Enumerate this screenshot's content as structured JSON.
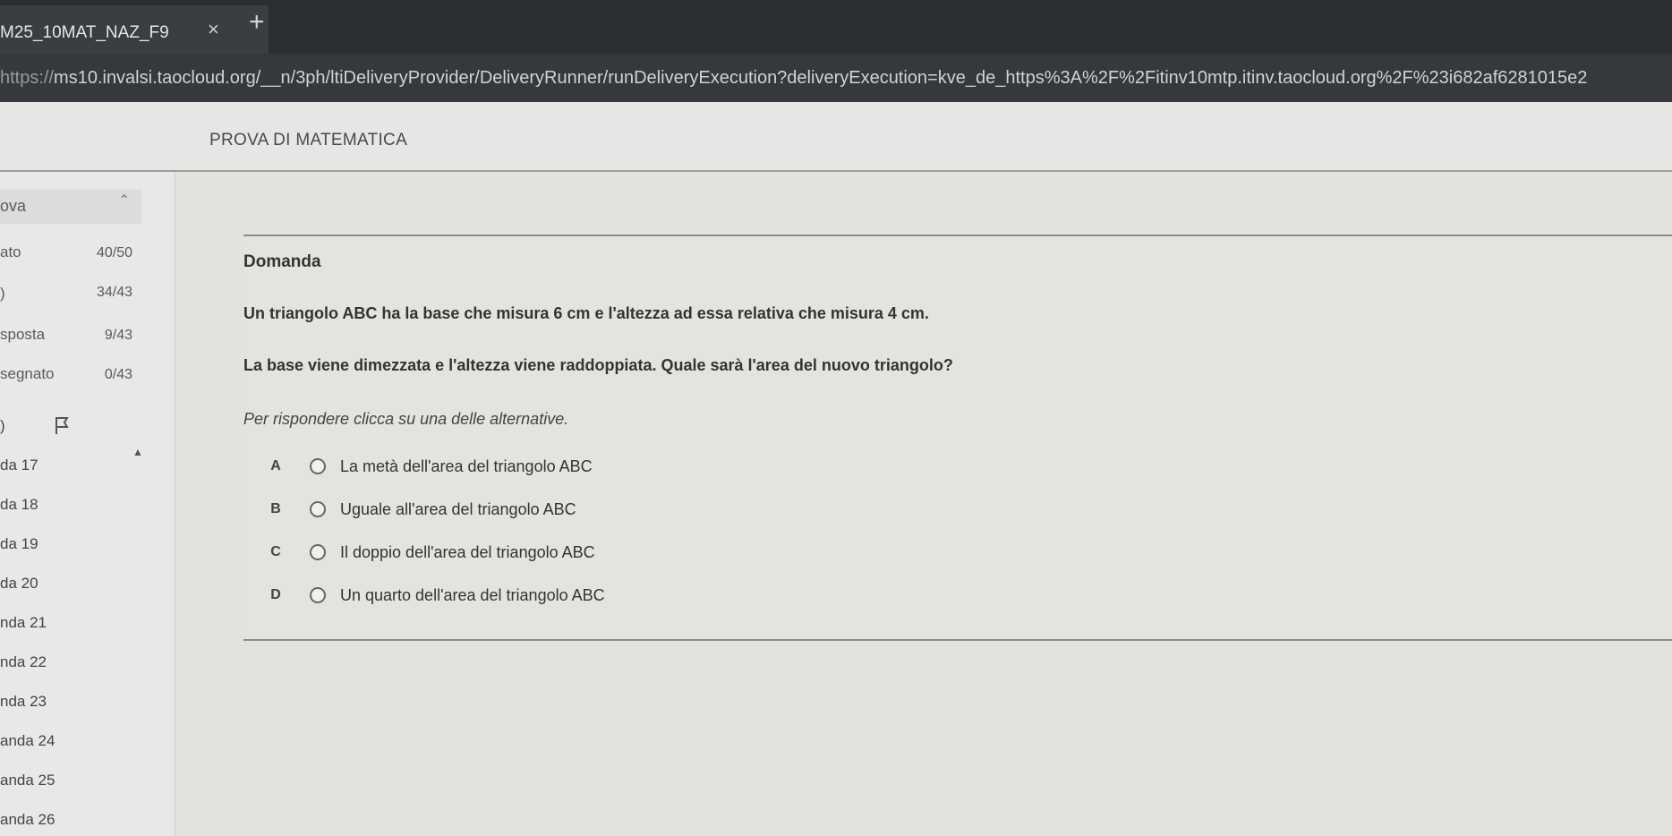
{
  "browser": {
    "tab_title": "M25_10MAT_NAZ_F9",
    "tab_close": "×",
    "new_tab": "+",
    "url_scheme": "https://",
    "url_rest": "ms10.invalsi.taocloud.org/__n/3ph/ltiDeliveryProvider/DeliveryRunner/runDeliveryExecution?deliveryExecution=kve_de_https%3A%2F%2Fitinv10mtp.itinv.taocloud.org%2F%23i682af6281015e2"
  },
  "test": {
    "title": "PROVA DI MATEMATICA"
  },
  "sidebar": {
    "header": "ova",
    "stats": [
      {
        "label": "ato",
        "value": "40/50"
      },
      {
        "label": ")",
        "value": "34/43"
      },
      {
        "label": "sposta",
        "value": "9/43"
      },
      {
        "label": "segnato",
        "value": "0/43"
      }
    ],
    "flag_label": ")",
    "items": [
      "da 17",
      "da 18",
      "da 19",
      "da 20",
      "nda 21",
      "nda 22",
      "nda 23",
      "anda 24",
      "anda 25",
      "anda 26"
    ]
  },
  "question": {
    "heading": "Domanda",
    "line1": "Un triangolo ABC ha la base che misura 6 cm e l'altezza ad essa relativa che misura 4 cm.",
    "line2": "La base viene dimezzata e l'altezza viene raddoppiata. Quale sarà l'area del nuovo triangolo?",
    "instruction": "Per rispondere clicca su una delle alternative.",
    "choices": [
      {
        "letter": "A",
        "text": "La metà dell'area del triangolo ABC"
      },
      {
        "letter": "B",
        "text": "Uguale all'area del triangolo ABC"
      },
      {
        "letter": "C",
        "text": "Il doppio dell'area del triangolo ABC"
      },
      {
        "letter": "D",
        "text": "Un quarto dell'area del triangolo ABC"
      }
    ]
  }
}
